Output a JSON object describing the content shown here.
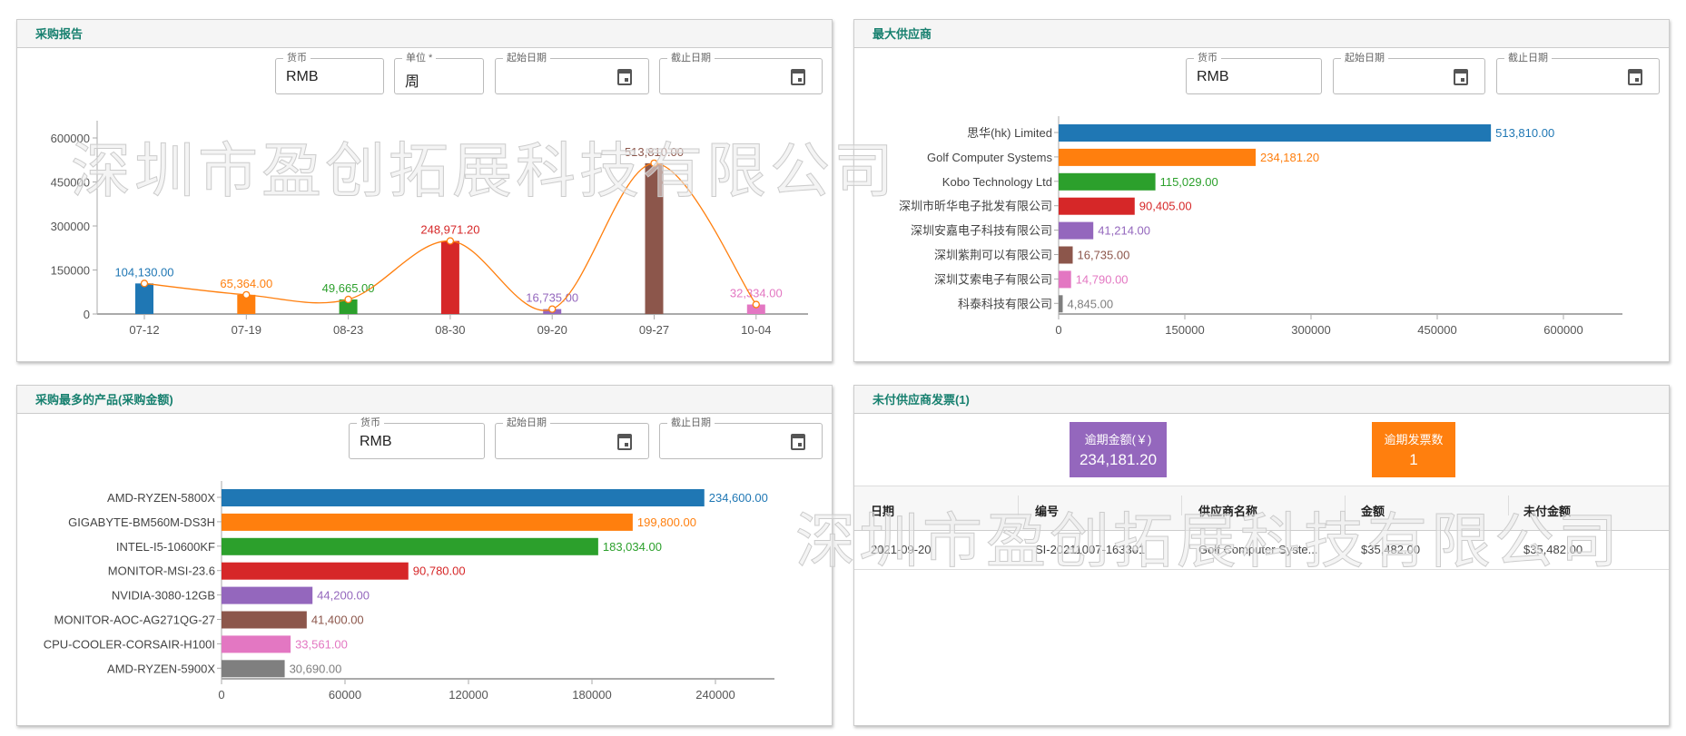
{
  "watermark": "深圳市盈创拓展科技有限公司",
  "panel_report": {
    "title": "采购报告",
    "currency_label": "货币",
    "currency": "RMB",
    "unit_label": "单位 *",
    "unit": "周",
    "start_label": "起始日期",
    "end_label": "截止日期"
  },
  "panel_supplier": {
    "title": "最大供应商",
    "currency_label": "货币",
    "currency": "RMB",
    "start_label": "起始日期",
    "end_label": "截止日期"
  },
  "panel_product": {
    "title": "采购最多的产品(采购金额)",
    "currency_label": "货币",
    "currency": "RMB",
    "start_label": "起始日期",
    "end_label": "截止日期"
  },
  "panel_invoice": {
    "title": "未付供应商发票(1)",
    "overdue_amount_label": "逾期金额(￥)",
    "overdue_amount": "234,181.20",
    "overdue_count_label": "逾期发票数",
    "overdue_count": "1",
    "columns": [
      "日期",
      "编号",
      "供应商名称",
      "金额",
      "未付金额"
    ],
    "rows": [
      [
        "2021-09-20",
        "SI-20211007-163301",
        "Golf Computer Syste...",
        "$35,482.00",
        "$35,482.00"
      ]
    ]
  },
  "colors": [
    "#1f77b4",
    "#ff7f0e",
    "#2ca02c",
    "#d62728",
    "#9467bd",
    "#8c564b",
    "#e377c2",
    "#7f7f7f"
  ],
  "chart_data": [
    {
      "type": "bar",
      "title": "采购报告",
      "categories": [
        "07-12",
        "07-19",
        "08-23",
        "08-30",
        "09-20",
        "09-27",
        "10-04"
      ],
      "values": [
        104130,
        65364,
        49665,
        248971.2,
        16735,
        513810,
        32334
      ],
      "labels": [
        "104,130.00",
        "65,364.00",
        "49,665.00",
        "248,971.20",
        "16,735.00",
        "513,810.00",
        "32,334.00"
      ],
      "yticks": [
        "0",
        "150000",
        "300000",
        "450000",
        "600000"
      ],
      "ylim": [
        0,
        600000
      ],
      "line_overlay": true
    },
    {
      "type": "bar",
      "orientation": "horizontal",
      "title": "最大供应商",
      "categories": [
        "思华(hk) Limited",
        "Golf Computer Systems",
        "Kobo Technology Ltd",
        "深圳市昕华电子批发有限公司",
        "深圳安嘉电子科技有限公司",
        "深圳紫荆可以有限公司",
        "深圳艾索电子有限公司",
        "科泰科技有限公司"
      ],
      "values": [
        513810,
        234181.2,
        115029,
        90405,
        41214,
        16735,
        14790,
        4845
      ],
      "labels": [
        "513,810.00",
        "234,181.20",
        "115,029.00",
        "90,405.00",
        "41,214.00",
        "16,735.00",
        "14,790.00",
        "4,845.00"
      ],
      "xticks": [
        "0",
        "150000",
        "300000",
        "450000",
        "600000"
      ],
      "xlim": [
        0,
        600000
      ]
    },
    {
      "type": "bar",
      "orientation": "horizontal",
      "title": "采购最多的产品(采购金额)",
      "categories": [
        "AMD-RYZEN-5800X",
        "GIGABYTE-BM560M-DS3H",
        "INTEL-I5-10600KF",
        "MONITOR-MSI-23.6",
        "NVIDIA-3080-12GB",
        "MONITOR-AOC-AG271QG-27",
        "CPU-COOLER-CORSAIR-H100I",
        "AMD-RYZEN-5900X"
      ],
      "values": [
        234600,
        199800,
        183034,
        90780,
        44200,
        41400,
        33561,
        30690
      ],
      "labels": [
        "234,600.00",
        "199,800.00",
        "183,034.00",
        "90,780.00",
        "44,200.00",
        "41,400.00",
        "33,561.00",
        "30,690.00"
      ],
      "xticks": [
        "0",
        "60000",
        "120000",
        "180000",
        "240000"
      ],
      "xlim": [
        0,
        240000
      ]
    }
  ]
}
